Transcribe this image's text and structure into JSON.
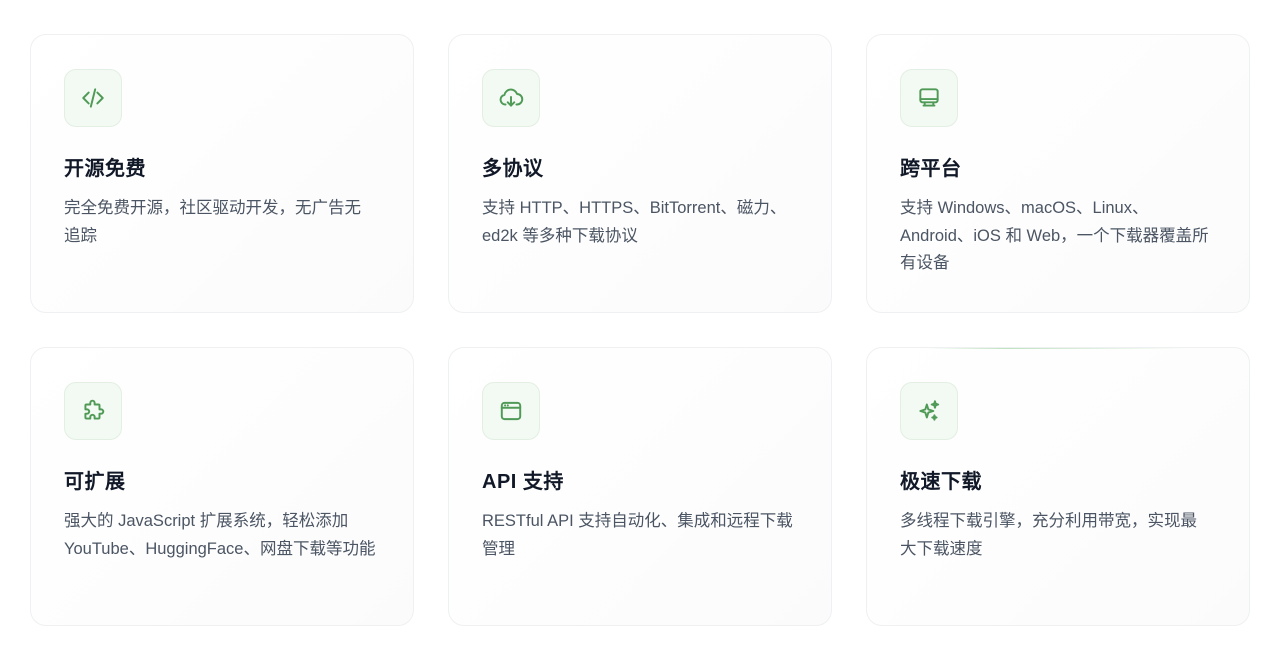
{
  "features": [
    {
      "icon": "code-icon",
      "title": "开源免费",
      "desc": "完全免费开源，社区驱动开发，无广告无追踪"
    },
    {
      "icon": "cloud-download-icon",
      "title": "多协议",
      "desc": "支持 HTTP、HTTPS、BitTorrent、磁力、ed2k 等多种下载协议"
    },
    {
      "icon": "monitor-icon",
      "title": "跨平台",
      "desc": "支持 Windows、macOS、Linux、Android、iOS 和 Web，一个下载器覆盖所有设备"
    },
    {
      "icon": "puzzle-icon",
      "title": "可扩展",
      "desc": "强大的 JavaScript 扩展系统，轻松添加 YouTube、HuggingFace、网盘下载等功能"
    },
    {
      "icon": "app-window-icon",
      "title": "API 支持",
      "desc": "RESTful API 支持自动化、集成和远程下载管理"
    },
    {
      "icon": "sparkles-icon",
      "title": "极速下载",
      "desc": "多线程下载引擎，充分利用带宽，实现最大下载速度"
    }
  ],
  "colors": {
    "accent": "#4f9a56",
    "icon_bg": "#f3f9f3",
    "title": "#111827",
    "text": "#4b5563",
    "border": "#eef0f2"
  }
}
